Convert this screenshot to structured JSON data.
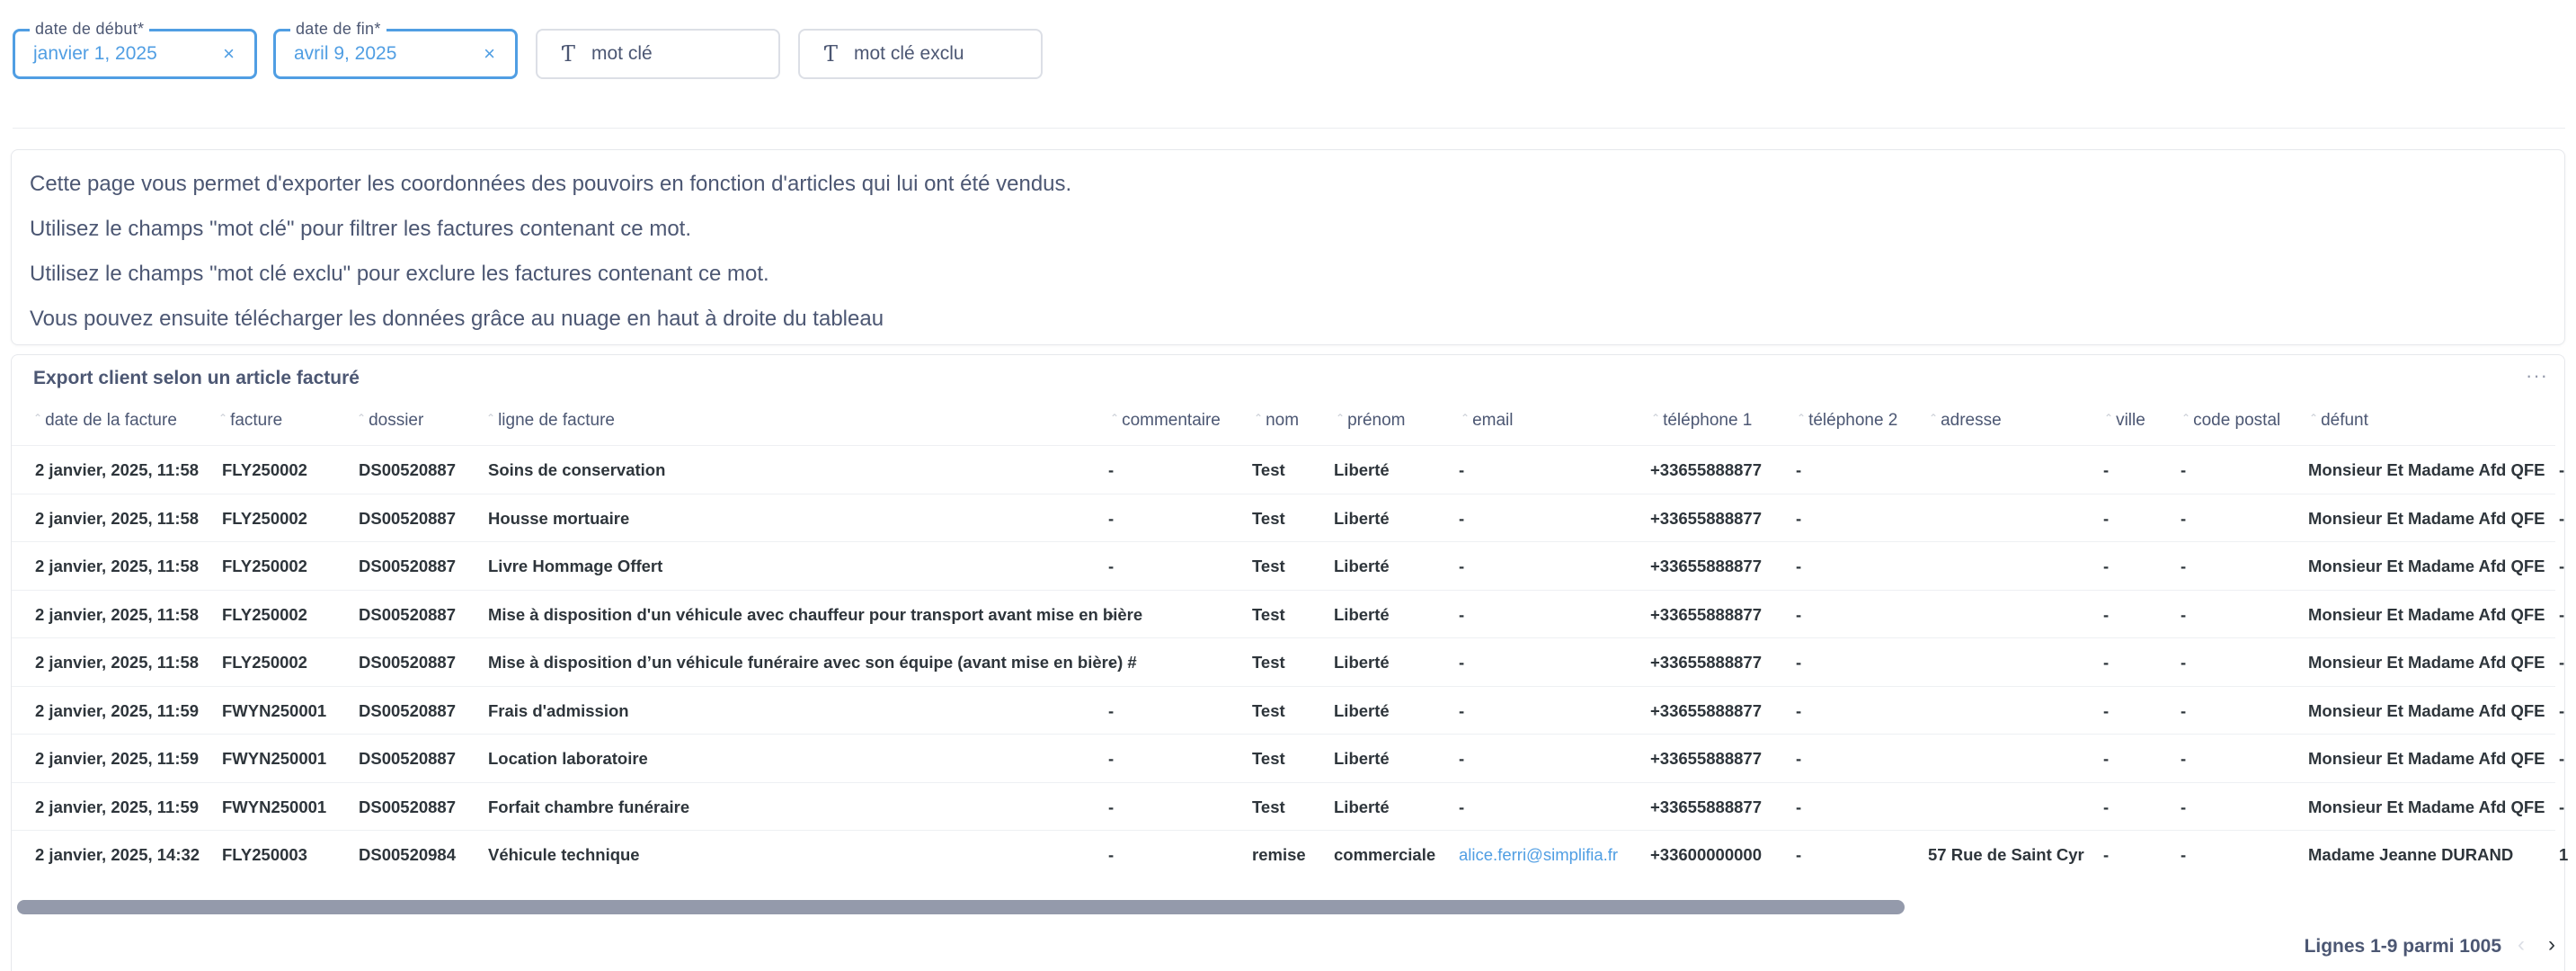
{
  "filters": {
    "start": {
      "label": "date de début*",
      "value": "janvier 1, 2025",
      "clear": "×"
    },
    "end": {
      "label": "date de fin*",
      "value": "avril 9, 2025",
      "clear": "×"
    },
    "keyword": {
      "icon": "Ƭ",
      "placeholder": "mot clé"
    },
    "excluded": {
      "icon": "Ƭ",
      "placeholder": "mot clé exclu"
    }
  },
  "info": {
    "line1": "Cette page vous permet d'exporter les coordonnées des pouvoirs en fonction d'articles qui lui ont été vendus.",
    "line2": "Utilisez le champs \"mot clé\" pour filtrer les factures contenant ce mot.",
    "line3": "Utilisez le champs \"mot clé exclu\" pour exclure les factures contenant ce mot.",
    "line4": "Vous pouvez ensuite télécharger les données grâce au nuage en haut à droite du tableau"
  },
  "table": {
    "title": "Export client selon un article facturé",
    "menu": "···",
    "columns": [
      "date de la facture",
      "facture",
      "dossier",
      "ligne de facture",
      "commentaire",
      "nom",
      "prénom",
      "email",
      "téléphone 1",
      "téléphone 2",
      "adresse",
      "ville",
      "code postal",
      "défunt"
    ],
    "rows": [
      [
        "2 janvier, 2025, 11:58",
        "FLY250002",
        "DS00520887",
        "Soins de conservation",
        "-",
        "Test",
        "Liberté",
        "-",
        "+33655888877",
        "-",
        "",
        "-",
        "-",
        "Monsieur Et Madame Afd QFE",
        "-"
      ],
      [
        "2 janvier, 2025, 11:58",
        "FLY250002",
        "DS00520887",
        "Housse mortuaire",
        "-",
        "Test",
        "Liberté",
        "-",
        "+33655888877",
        "-",
        "",
        "-",
        "-",
        "Monsieur Et Madame Afd QFE",
        "-"
      ],
      [
        "2 janvier, 2025, 11:58",
        "FLY250002",
        "DS00520887",
        "Livre Hommage Offert",
        "-",
        "Test",
        "Liberté",
        "-",
        "+33655888877",
        "-",
        "",
        "-",
        "-",
        "Monsieur Et Madame Afd QFE",
        "-"
      ],
      [
        "2 janvier, 2025, 11:58",
        "FLY250002",
        "DS00520887",
        "Mise à disposition d'un véhicule avec chauffeur pour transport avant mise en bière",
        "-",
        "Test",
        "Liberté",
        "-",
        "+33655888877",
        "-",
        "",
        "-",
        "-",
        "Monsieur Et Madame Afd QFE",
        "-"
      ],
      [
        "2 janvier, 2025, 11:58",
        "FLY250002",
        "DS00520887",
        "Mise à disposition d’un véhicule funéraire avec son équipe (avant mise en bière) #",
        "-",
        "Test",
        "Liberté",
        "-",
        "+33655888877",
        "-",
        "",
        "-",
        "-",
        "Monsieur Et Madame Afd QFE",
        "-"
      ],
      [
        "2 janvier, 2025, 11:59",
        "FWYN250001",
        "DS00520887",
        "Frais d'admission",
        "-",
        "Test",
        "Liberté",
        "-",
        "+33655888877",
        "-",
        "",
        "-",
        "-",
        "Monsieur Et Madame Afd QFE",
        "-"
      ],
      [
        "2 janvier, 2025, 11:59",
        "FWYN250001",
        "DS00520887",
        "Location laboratoire",
        "-",
        "Test",
        "Liberté",
        "-",
        "+33655888877",
        "-",
        "",
        "-",
        "-",
        "Monsieur Et Madame Afd QFE",
        "-"
      ],
      [
        "2 janvier, 2025, 11:59",
        "FWYN250001",
        "DS00520887",
        "Forfait chambre funéraire",
        "-",
        "Test",
        "Liberté",
        "-",
        "+33655888877",
        "-",
        "",
        "-",
        "-",
        "Monsieur Et Madame Afd QFE",
        "-"
      ],
      [
        "2 janvier, 2025, 14:32",
        "FLY250003",
        "DS00520984",
        "Véhicule technique",
        "-",
        "remise",
        "commerciale",
        "alice.ferri@simplifia.fr",
        "+33600000000",
        "-",
        "57 Rue de Saint Cyr",
        "-",
        "-",
        "Madame Jeanne DURAND",
        "1"
      ]
    ],
    "pager": "Lignes 1-9 parmi 1005",
    "prev": "‹",
    "next": "›"
  }
}
